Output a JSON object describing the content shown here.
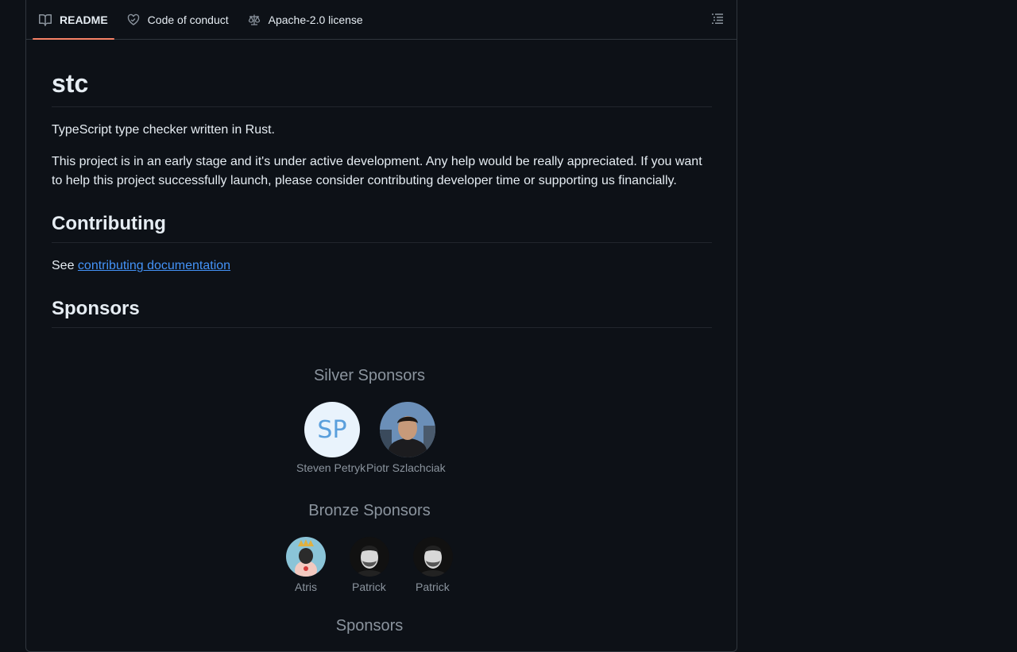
{
  "tabs": [
    {
      "label": "README",
      "icon": "book-icon",
      "active": true
    },
    {
      "label": "Code of conduct",
      "icon": "heart-handshake-icon",
      "active": false
    },
    {
      "label": "Apache-2.0 license",
      "icon": "law-scale-icon",
      "active": false
    }
  ],
  "outline_icon": "list-outline-icon",
  "readme": {
    "title": "stc",
    "intro": "TypeScript type checker written in Rust.",
    "status": "This project is in an early stage and it's under active development. Any help would be really appreciated. If you want to help this project successfully launch, please consider contributing developer time or supporting us financially.",
    "contributing_heading": "Contributing",
    "contributing_prefix": "See ",
    "contributing_link": "contributing documentation",
    "sponsors_heading": "Sponsors"
  },
  "silver": {
    "title": "Silver Sponsors",
    "members": [
      {
        "name": "Steven Petryk",
        "initials": "SP"
      },
      {
        "name": "Piotr Szlachciak"
      }
    ]
  },
  "bronze": {
    "title": "Bronze Sponsors",
    "members": [
      {
        "name": "Atris"
      },
      {
        "name": "Patrick"
      },
      {
        "name": "Patrick"
      }
    ]
  },
  "sponsors_tier": {
    "title": "Sponsors"
  },
  "colors": {
    "accent_underline": "#f78166",
    "link": "#4493f8",
    "background": "#0d1117",
    "muted_text": "#8b949e"
  }
}
